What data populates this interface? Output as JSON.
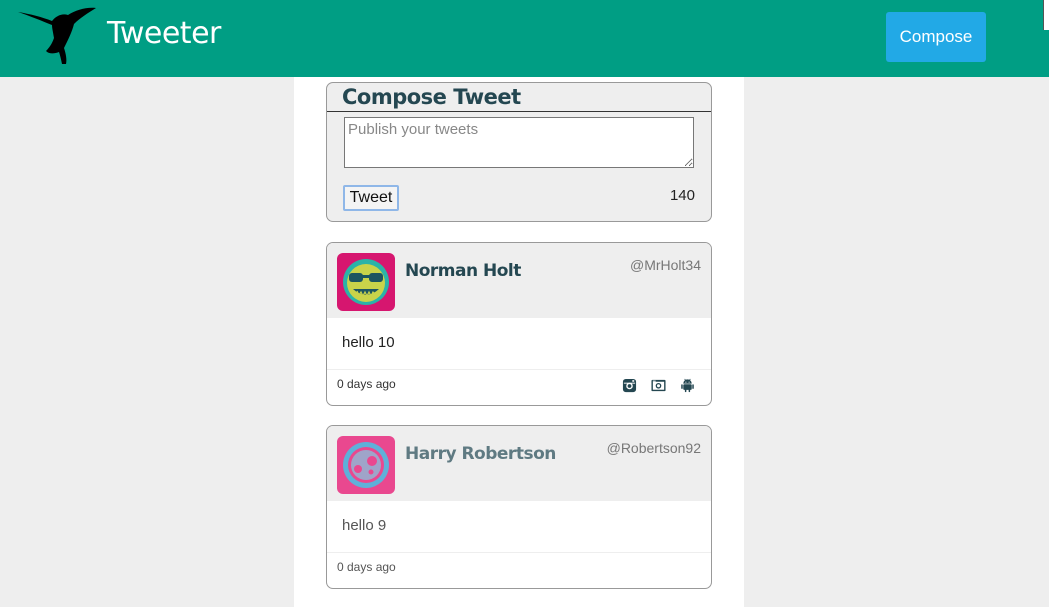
{
  "header": {
    "brand": "Tweeter",
    "compose_label": "Compose",
    "bg_color": "#009e84",
    "button_color": "#22a9e6"
  },
  "compose": {
    "title": "Compose Tweet",
    "placeholder": "Publish your tweets",
    "submit_label": "Tweet",
    "counter": "140"
  },
  "tweets": [
    {
      "name": "Norman Holt",
      "handle": "@MrHolt34",
      "text": "hello 10",
      "time": "0 days ago",
      "avatar_bg": "#d6166f",
      "actions": [
        "instagram-icon",
        "camera-icon",
        "android-icon"
      ]
    },
    {
      "name": "Harry Robertson",
      "handle": "@Robertson92",
      "text": "hello 9",
      "time": "0 days ago",
      "avatar_bg": "#e9488f",
      "actions": []
    }
  ]
}
